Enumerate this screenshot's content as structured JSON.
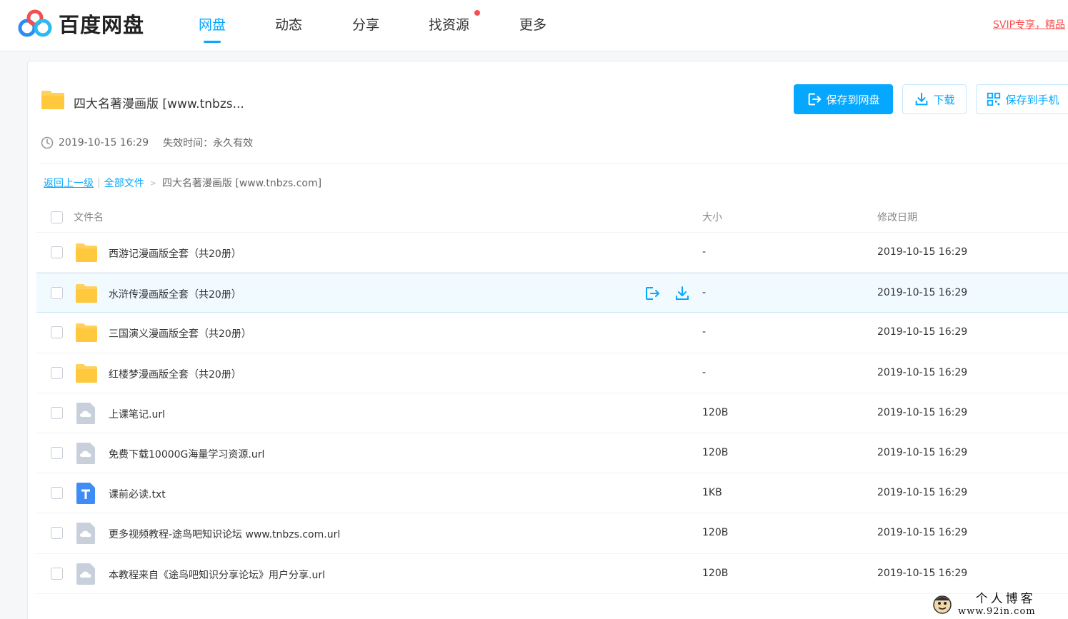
{
  "brand": {
    "name": "百度网盘"
  },
  "nav": [
    {
      "label": "网盘",
      "active": true
    },
    {
      "label": "动态",
      "active": false
    },
    {
      "label": "分享",
      "active": false
    },
    {
      "label": "找资源",
      "active": false,
      "dot": true
    },
    {
      "label": "更多",
      "active": false
    }
  ],
  "promo": {
    "text": "SVIP专享，精品"
  },
  "share": {
    "title": "四大名著漫画版 [www.tnbzs...",
    "created": "2019-10-15 16:29",
    "expire": "失效时间：永久有效",
    "buttons": {
      "save": "保存到网盘",
      "download": "下载",
      "phone": "保存到手机"
    }
  },
  "breadcrumb": {
    "back": "返回上一级",
    "sep": "|",
    "all": "全部文件",
    "arrow": ">",
    "current": "四大名著漫画版 [www.tnbzs.com]"
  },
  "table": {
    "headers": {
      "name": "文件名",
      "size": "大小",
      "date": "修改日期"
    },
    "rows": [
      {
        "name": "西游记漫画版全套（共20册）",
        "size": "-",
        "date": "2019-10-15 16:29",
        "type": "folder-icon"
      },
      {
        "name": "水浒传漫画版全套（共20册）",
        "size": "-",
        "date": "2019-10-15 16:29",
        "type": "folder-icon"
      },
      {
        "name": "三国演义漫画版全套（共20册）",
        "size": "-",
        "date": "2019-10-15 16:29",
        "type": "folder-icon"
      },
      {
        "name": "红楼梦漫画版全套（共20册）",
        "size": "-",
        "date": "2019-10-15 16:29",
        "type": "folder-icon"
      },
      {
        "name": "上课笔记.url",
        "size": "120B",
        "date": "2019-10-15 16:29",
        "type": "url-file-icon"
      },
      {
        "name": "免费下载10000G海量学习资源.url",
        "size": "120B",
        "date": "2019-10-15 16:29",
        "type": "url-file-icon"
      },
      {
        "name": "课前必读.txt",
        "size": "1KB",
        "date": "2019-10-15 16:29",
        "type": "txt-file-icon"
      },
      {
        "name": "更多视频教程-途鸟吧知识论坛 www.tnbzs.com.url",
        "size": "120B",
        "date": "2019-10-15 16:29",
        "type": "url-file-icon"
      },
      {
        "name": "本教程来自《途鸟吧知识分享论坛》用户分享.url",
        "size": "120B",
        "date": "2019-10-15 16:29",
        "type": "url-file-icon"
      }
    ]
  },
  "watermark": {
    "title": "个人博客",
    "url": "www.92in.com"
  },
  "colors": {
    "accent": "#06a7ff",
    "folder": "#ffd15c",
    "alert": "#f85050"
  }
}
